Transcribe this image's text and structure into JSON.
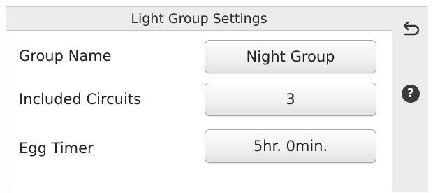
{
  "header": {
    "title": "Light Group Settings"
  },
  "rows": [
    {
      "label": "Group Name",
      "value": "Night Group"
    },
    {
      "label": "Included Circuits",
      "value": "3"
    },
    {
      "label": "Egg Timer",
      "value": "5hr. 0min."
    }
  ],
  "sidebar": {
    "back_icon": "back-arrow-icon",
    "help_icon": "help-icon",
    "help_glyph": "?"
  }
}
